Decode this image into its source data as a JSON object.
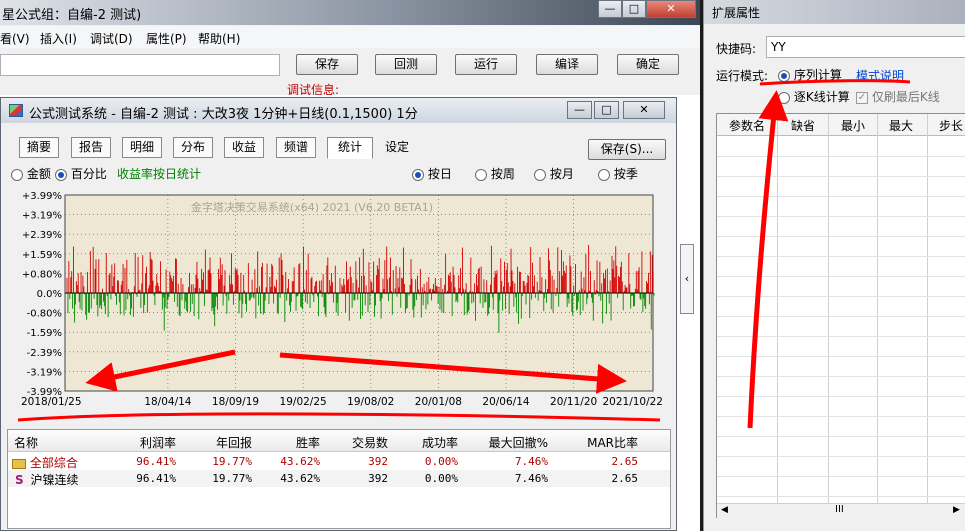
{
  "bg_window": {
    "title": "星公式组：自编-2 测试)",
    "menu": [
      "看(V)",
      "插入(I)",
      "调试(D)",
      "属性(P)",
      "帮助(H)"
    ],
    "buttons": {
      "save": "保存",
      "backtest": "回测",
      "run": "运行",
      "compile": "编译",
      "ok": "确定"
    },
    "debug_label": "调试信息:"
  },
  "test_window": {
    "title": "公式测试系统 - 自编-2 测试 : 大改3夜 1分钟+日线(0.1,1500) 1分",
    "tabs": [
      "摘要",
      "报告",
      "明细",
      "分布",
      "收益",
      "频谱",
      "统计",
      "设定"
    ],
    "active_tab": "统计",
    "save_button": "保存(S)...",
    "mode_options": [
      {
        "label": "金额",
        "checked": false
      },
      {
        "label": "百分比",
        "checked": true
      }
    ],
    "daily_pct_label": "收益率按日统计",
    "period_options": [
      {
        "label": "按日",
        "checked": true
      },
      {
        "label": "按周",
        "checked": false
      },
      {
        "label": "按月",
        "checked": false
      },
      {
        "label": "按季",
        "checked": false
      }
    ],
    "table": {
      "headers": [
        "名称",
        "利润率",
        "年回报",
        "胜率",
        "交易数",
        "成功率",
        "最大回撤%",
        "MAR比率"
      ],
      "rows": [
        {
          "icon": "folder-icon",
          "name": "全部综合",
          "values": [
            "96.41%",
            "19.77%",
            "43.62%",
            "392",
            "0.00%",
            "7.46%",
            "2.65"
          ]
        },
        {
          "icon": "s-icon",
          "name": "沪镍连续",
          "values": [
            "96.41%",
            "19.77%",
            "43.62%",
            "392",
            "0.00%",
            "7.46%",
            "2.65"
          ]
        }
      ]
    }
  },
  "chart_data": {
    "type": "bar",
    "watermark": "金字塔决策交易系统(x64) 2021 (V6.20 BETA1)",
    "y_ticks": [
      "+3.99%",
      "+3.19%",
      "+2.39%",
      "+1.59%",
      "+0.80%",
      "0.0%",
      "-0.80%",
      "-1.59%",
      "-2.39%",
      "-3.19%",
      "-3.99%"
    ],
    "ylim": [
      -3.99,
      3.99
    ],
    "x_ticks": [
      "2018/01/25",
      "18/04/14",
      "18/09/19",
      "19/02/25",
      "19/08/02",
      "20/01/08",
      "20/06/14",
      "20/11/20",
      "2021/10/22"
    ],
    "grid": true,
    "colors": {
      "positive": "#d40000",
      "negative": "#008a00",
      "background": "#ede7d3"
    },
    "values": [
      0.62,
      -0.82,
      1.3,
      -0.25,
      0.64,
      0.89,
      -0.64,
      1.89,
      -1.2,
      -0.47,
      0.48,
      0.32,
      0.8,
      -0.37,
      -0.64,
      0.85,
      -0.72,
      0.71,
      0.27,
      -0.06,
      -0.89,
      -1.09,
      0.86,
      -0.8,
      -0.79,
      1.71,
      -0.63,
      -0.04,
      1.88,
      -0.23,
      0.98,
      1.37,
      -0.49,
      -0.95,
      1.38,
      -0.61,
      -0.5,
      -0.66,
      0.18,
      -0.35,
      -0.54,
      -0.86,
      1.63,
      -0.12,
      -0.98,
      0.74,
      0.82,
      -0.26,
      1.16,
      0.28,
      0.67,
      1.21,
      -0.12,
      -0.48,
      0.52,
      0.5,
      -0.38,
      -0.87,
      0.33,
      0.49,
      1.18,
      -0.91,
      1.02,
      -0.7,
      1.35,
      -0.25,
      0.16,
      -0.1,
      -0.9,
      -0.63,
      0.04,
      -0.97,
      0.28,
      1.63,
      -0.06,
      -0.16,
      1.47,
      0.1,
      0.13,
      -0.6,
      0.39,
      1.54,
      -0.82,
      -0.49,
      0.81,
      1.07,
      -0.8,
      0.19,
      0.32,
      1.67,
      1.4,
      1.35,
      0.5,
      -0.1,
      -0.49,
      0.3,
      0.77,
      0.42,
      0.28,
      0.08,
      1.29,
      0.06,
      -0.68,
      -0.18,
      -1.53,
      -0.59,
      0.96,
      -0.64,
      -0.28,
      -0.16,
      0.87,
      0.72,
      0.6,
      0.48,
      0.7,
      -0.36,
      1.41,
      1.39,
      -0.56,
      0.38,
      -0.91,
      -0.94,
      0.61,
      -0.3,
      0.36,
      -0.02,
      -0.64,
      -0.35,
      -0.73,
      -0.79,
      0.24,
      0.82,
      -0.77,
      0.35,
      -0.44,
      0.36,
      -0.94,
      0.21,
      0.75,
      1.27,
      0.58,
      -1.07,
      0.2,
      0.08,
      0.98,
      0.54,
      0.84,
      -0.53,
      1.77,
      0.14,
      0.13,
      0.92,
      0.96,
      1.45,
      0.81,
      -0.73,
      -0.61,
      -0.88,
      -1.35,
      -0.55,
      -0.15,
      -0.68,
      0.98,
      0.57,
      1.44,
      0.73,
      1.17,
      -0.51,
      0.3,
      0.93,
      -0.11,
      -0.85,
      0.05,
      -0.31,
      0.73,
      0.36,
      1.62,
      0.35,
      -0.48,
      0.09,
      1.01,
      0.92,
      0.99,
      0.74,
      -0.83,
      -0.31,
      0.82,
      -1.01,
      -0.44,
      0.74,
      0.09,
      -0.44,
      -0.76,
      0.01,
      1.22,
      -0.31,
      -0.29,
      -0.2,
      0.54,
      -0.17,
      -0.23,
      0.97,
      -1.03,
      0.2,
      1.69,
      -0.51,
      0.27,
      -0.84,
      1.06,
      1.23,
      -0.88,
      -0.81,
      -0.31,
      0.23,
      1.2,
      0.01,
      -0.45,
      0.66,
      0.25,
      1.19,
      1.11,
      -0.43,
      0.29,
      0.23,
      0.54,
      -0.82,
      -0.85,
      1.44,
      -0.2,
      1.62,
      1.34,
      0.73,
      0.01,
      -1.18,
      0.86,
      -0.31,
      0.19,
      0.57,
      -0.5,
      -0.77,
      -0.36,
      0.48,
      0.49,
      1.04,
      -0.01,
      -0.72,
      -0.14,
      -0.12,
      1.17,
      1.21,
      -0.56,
      -0.59,
      -0.67,
      1.89,
      0.14,
      -0.37,
      0.93,
      -0.44,
      1.6,
      -0.01,
      -0.61,
      0.59,
      0.66,
      -0.09,
      -0.37,
      0.29,
      0.46,
      0.5,
      -0.14,
      -0.94,
      0.5,
      0.12,
      0.51,
      -0.16,
      0.77,
      -0.57,
      -0.85,
      -0.98,
      1.12,
      1.45,
      -0.05,
      0.53,
      0.3,
      0.81,
      0.44,
      -0.39,
      0.03,
      1.11,
      -0.79,
      -0.4,
      -0.93,
      0.01,
      0.61,
      -0.02,
      0.34,
      0.26,
      0.58,
      0.34,
      -0.81,
      1.28,
      0.52,
      0.58,
      -1.13,
      1.08,
      0.65,
      -0.6,
      0.41,
      -0.31,
      -0.28,
      1.29,
      0.55,
      -0.28,
      0.22,
      1.45,
      -1.06,
      0.7,
      -0.92,
      1.8,
      0.71,
      -0.5,
      0.31,
      0.02,
      -0.78,
      1.25,
      -0.5,
      0.51,
      0.44,
      0.12,
      1.28,
      -0.97,
      -0.51,
      0.73,
      1.13,
      0.97,
      1.42,
      -0.33,
      -1.04,
      -0.22,
      0.58,
      0.16,
      1.34,
      -0.05,
      1.89,
      0.56,
      -0.33,
      0.63,
      1.44,
      0.08,
      -0.88,
      0.93,
      -0.02,
      0.18,
      1.1,
      -0.15,
      0.61,
      0.23,
      1.04,
      -0.6,
      0.63,
      0.59,
      1.85,
      0.36,
      -0.82,
      -0.65,
      -0.61,
      -0.02,
      -0.1,
      0.33,
      1.38,
      0.58,
      -0.68,
      -1.0,
      -0.54,
      0.56,
      -0.29,
      0.71,
      0.15,
      -0.06,
      0.98,
      -1.0,
      0.23,
      -0.5,
      0.37,
      0.08,
      -0.67,
      0.45,
      -0.47,
      0.65,
      0.16,
      0.18,
      -0.3,
      0.16,
      0.37,
      0.1,
      0.61,
      0.29,
      0.27,
      -0.44,
      0.25,
      -0.68,
      0.61,
      -0.78,
      0.17,
      -0.82,
      0.34,
      1.6,
      -0.03,
      0.09,
      0.75,
      0.69,
      0.84,
      0.46,
      -0.94,
      1.07,
      0.74,
      0.23,
      -0.36,
      -0.3,
      -0.39,
      0.72,
      0.2,
      1.01,
      -0.11,
      1.85,
      0.18,
      -0.9,
      0.14,
      0.4,
      -0.88,
      -0.79,
      -0.7,
      0.08,
      1.44,
      -0.42,
      0.06,
      -0.38,
      0.39,
      -1.13,
      0.77,
      0.3,
      0.98,
      1.03,
      -0.42,
      1.08,
      0.03,
      -0.6,
      0.56,
      -0.39,
      -0.37,
      0.52,
      -0.93,
      -0.85,
      -0.59,
      0.34,
      1.92,
      -0.18,
      -0.68,
      0.64,
      0.9,
      0.78,
      0.93,
      -0.82,
      -1.62,
      -0.3,
      1.41,
      0.49,
      -0.72,
      0.27,
      1.28,
      -0.66,
      0.95,
      1.22,
      0.43,
      -0.85,
      0.27,
      1.8,
      0.92,
      0.49,
      -0.56,
      0.4,
      -0.18,
      -0.79,
      1.07,
      -1.25,
      0.87,
      0.86,
      -1.04,
      -0.12,
      0.49,
      0.48,
      0.3,
      -0.47,
      0.41,
      0.74,
      0.69,
      -1.02,
      1.87,
      -0.27,
      1.23,
      0.28,
      0.72,
      -0.2,
      0.01,
      0.46,
      -0.31,
      0.12,
      1.46,
      0.08,
      0.64,
      -0.03,
      -0.74,
      -0.2,
      0.56,
      -0.4,
      0.17,
      1.82,
      1.33,
      0.94,
      -0.66,
      0.71,
      -0.8,
      0.54,
      -0.02,
      -0.12,
      0.21,
      1.86,
      -0.55,
      0.89,
      -0.04,
      1.75,
      0.7,
      1.28,
      0.9,
      0.8,
      1.12,
      -0.57,
      -0.22,
      -0.43,
      1.53,
      1.09,
      -0.77,
      -0.92,
      0.31,
      -0.11,
      1.18,
      -0.71,
      -0.67,
      -0.35,
      0.12,
      -0.9,
      0.87,
      0.18,
      -0.71,
      0.64,
      0.11,
      1.58,
      -0.46,
      -0.22,
      1.96,
      0.09,
      0.9,
      -0.19,
      -0.4,
      -1.13,
      0.52,
      -0.08,
      0.12,
      1.33,
      0.07,
      -0.13,
      1.27,
      -0.31,
      0.39,
      -1.24,
      0.82,
      0.59,
      0.94,
      -0.85,
      1.0,
      0.08,
      -0.43,
      0.51,
      -1.12,
      1.51,
      0.98,
      1.33,
      0.64,
      1.9,
      1.11,
      -0.2,
      0.7,
      0.65,
      1.06,
      1.27,
      0.47,
      -0.7,
      0.09,
      0.33,
      0.22,
      0.23,
      -0.04,
      1.62,
      0.37,
      -0.63,
      -0.12,
      -0.11,
      -0.55,
      -0.53,
      0.17,
      0.89,
      0.15,
      0.91,
      1.05,
      -0.23,
      -0.28,
      1.69,
      -0.78,
      -0.22,
      -0.53,
      -0.65,
      0.49,
      0.4,
      0.82,
      -0.46,
      1.7,
      -1.49,
      1.55,
      0.88,
      -0.1
    ]
  },
  "prop_panel": {
    "title": "扩展属性",
    "shortcut_label": "快捷码:",
    "shortcut_value": "YY",
    "run_mode_label": "运行模式:",
    "mode_series": "序列计算",
    "mode_doc_link": "模式说明",
    "mode_tick": "逐K线计算",
    "refresh_last": "仅刷最后K线",
    "grid_headers": [
      "参数名",
      "缺省",
      "最小",
      "最大",
      "步长"
    ],
    "scroll_thumb": "III"
  }
}
